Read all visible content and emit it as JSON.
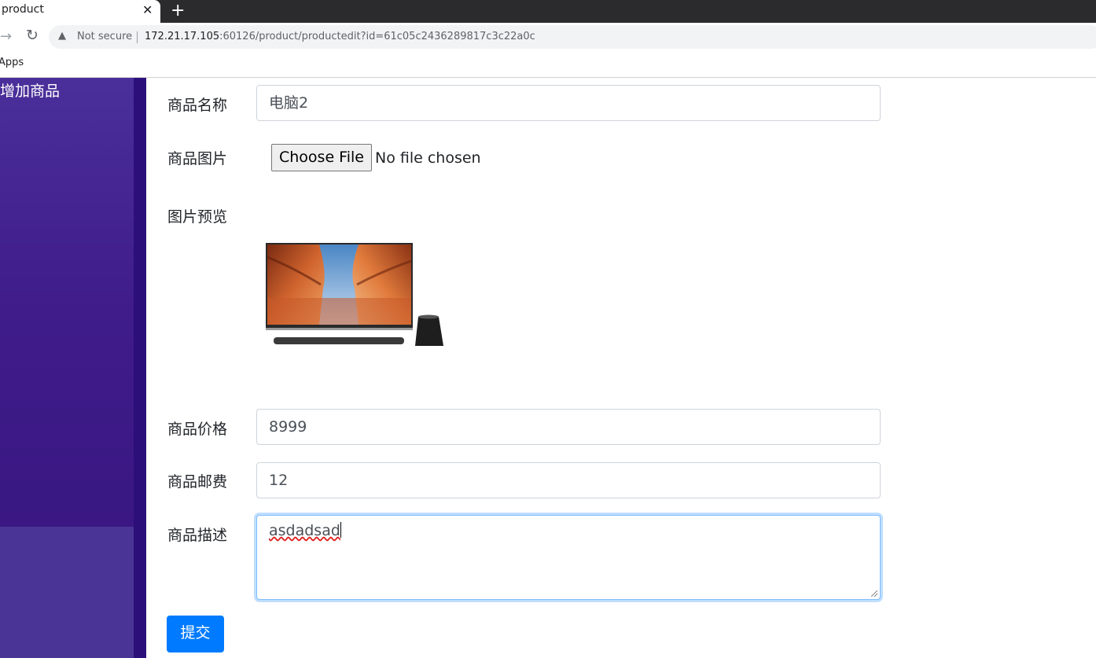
{
  "browser": {
    "tab_title": "product",
    "tab_close": "✕",
    "new_tab": "+",
    "security_label": "Not secure",
    "url_host": "172.21.17.105",
    "url_rest": ":60126/product/productedit?id=61c05c2436289817c3c22a0c",
    "bookmark_apps": "Apps",
    "icons": {
      "forward": "forward-arrow-icon",
      "reload": "reload-icon",
      "warning": "warning-icon"
    }
  },
  "sidebar": {
    "items": [
      {
        "label": "增加商品"
      }
    ],
    "colors": {
      "top": "#4a2f9a",
      "bottom": "#4a3597",
      "strip": "#2d0f7a"
    }
  },
  "form": {
    "name": {
      "label": "商品名称",
      "value": "电脑2"
    },
    "image": {
      "label": "商品图片",
      "button": "Choose File",
      "status": "No file chosen"
    },
    "preview": {
      "label": "图片预览"
    },
    "price": {
      "label": "商品价格",
      "value": "8999"
    },
    "shipping": {
      "label": "商品邮费",
      "value": "12"
    },
    "description": {
      "label": "商品描述",
      "value": "asdadsad"
    },
    "submit": {
      "label": "提交",
      "color": "#007bff"
    }
  }
}
